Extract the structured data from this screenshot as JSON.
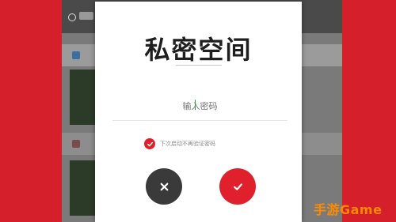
{
  "background": {
    "accent": "#d8202c"
  },
  "dialog": {
    "title": "私密空间",
    "password_placeholder": "输入密码",
    "remember_label": "下次启动不再验证密码",
    "remember_checked": true,
    "cancel_icon": "close-icon",
    "confirm_icon": "check-icon",
    "colors": {
      "confirm": "#e0202c",
      "cancel": "#3a3a3a"
    }
  },
  "watermark": {
    "text": "手游Game"
  }
}
